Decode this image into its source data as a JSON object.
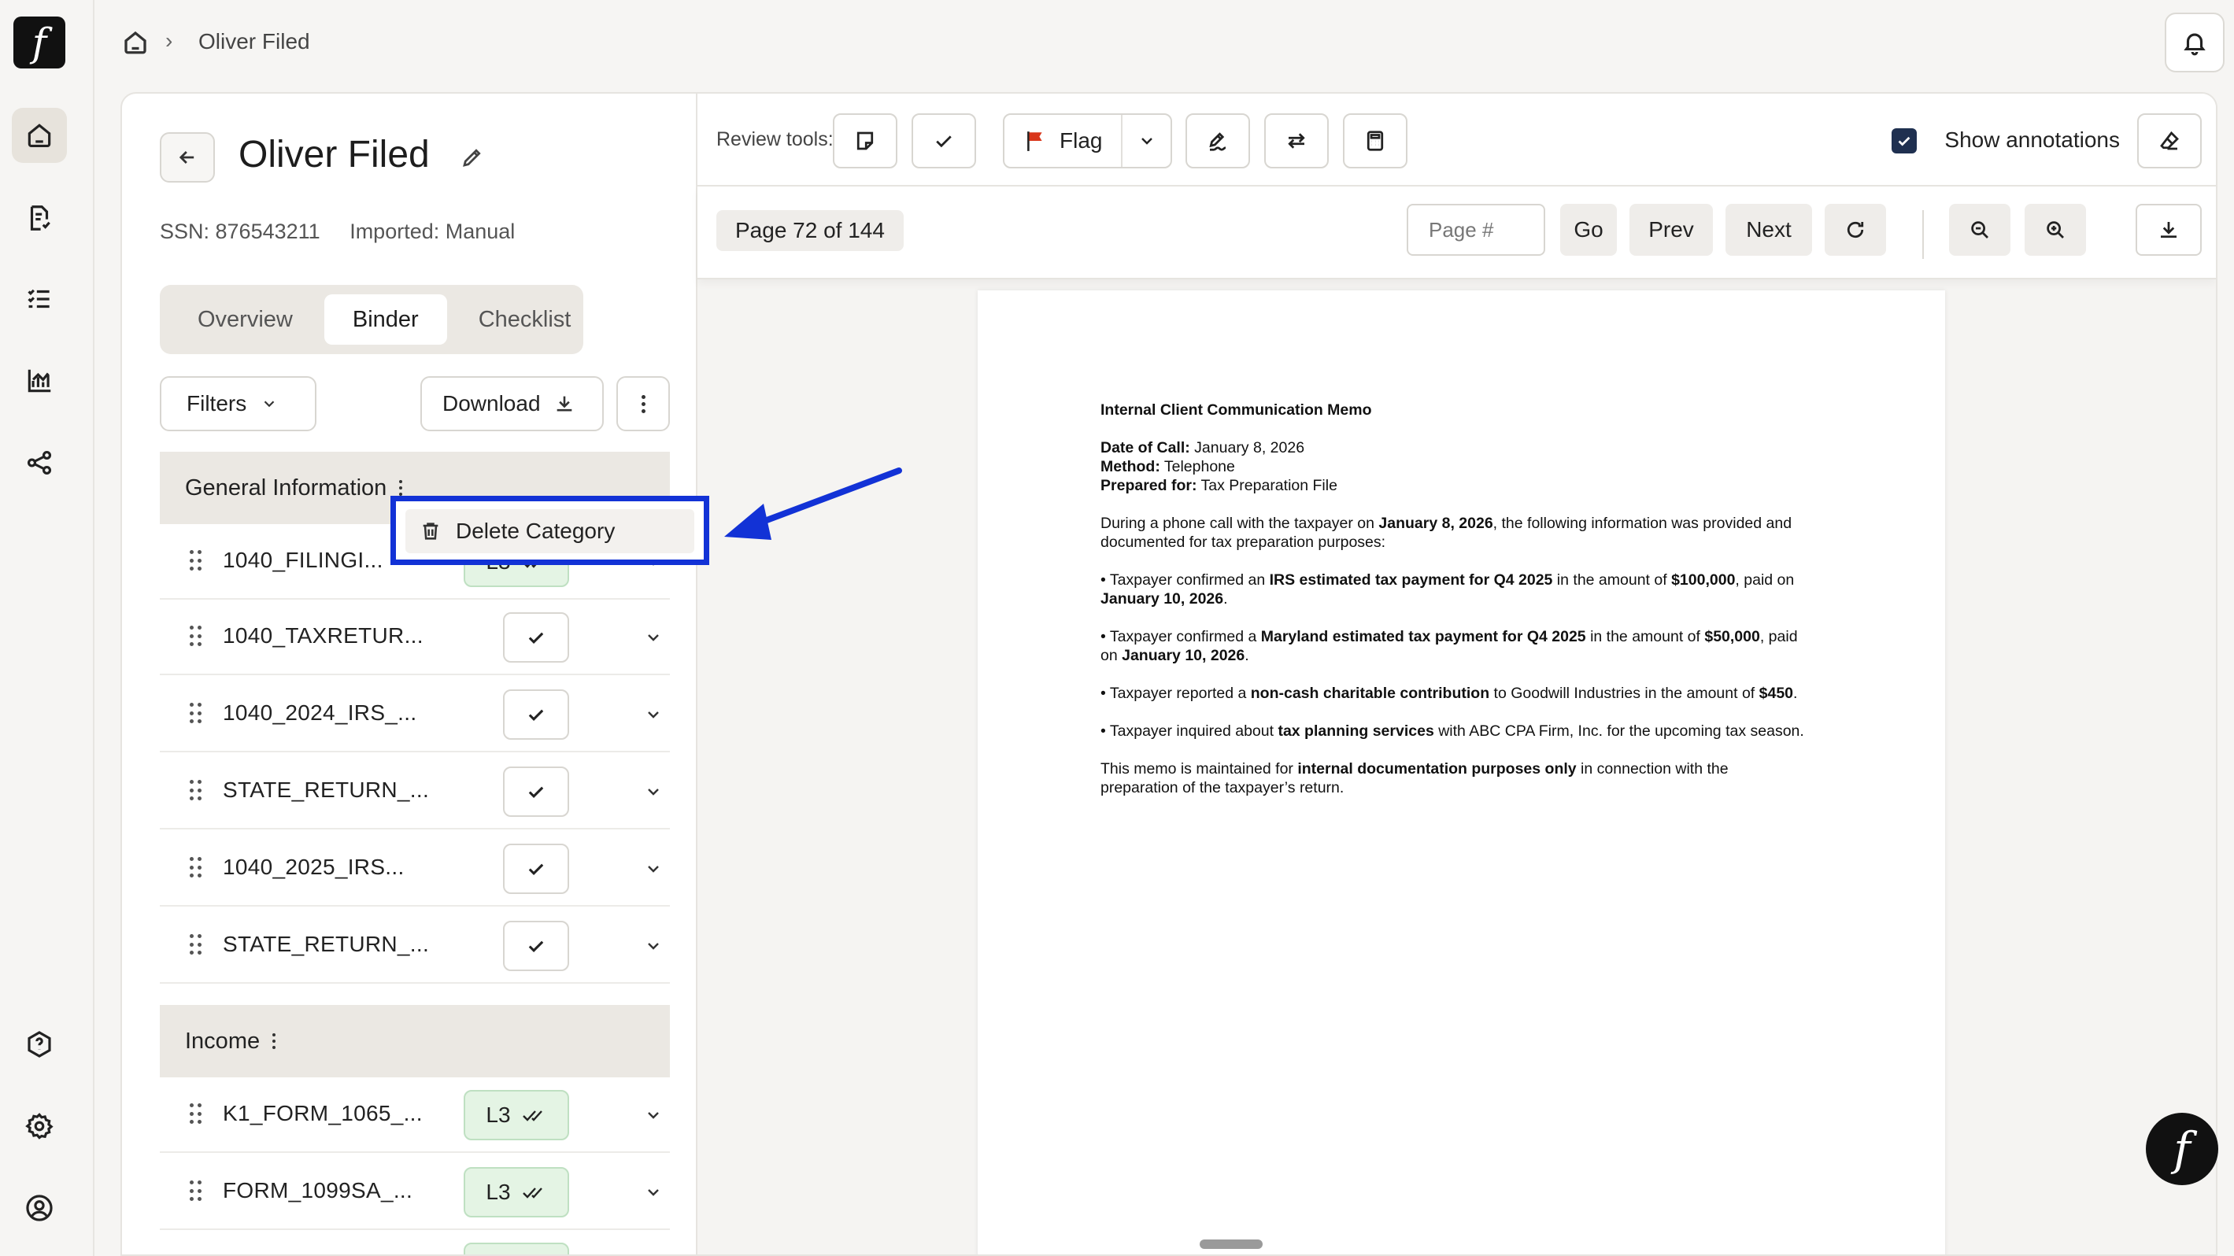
{
  "app": {
    "logo_glyph": "f",
    "fab_glyph": "f",
    "accent_color": "#1232d6"
  },
  "rail": {
    "icons": [
      "home-icon",
      "document-icon",
      "checklist-icon",
      "analytics-icon",
      "share-icon",
      "help-icon",
      "settings-icon",
      "account-icon"
    ]
  },
  "breadcrumb": {
    "current": "Oliver Filed",
    "separator": "›"
  },
  "client": {
    "name": "Oliver Filed",
    "ssn": "SSN: 876543211",
    "imported": "Imported: Manual"
  },
  "tabs": [
    "Overview",
    "Binder",
    "Checklist"
  ],
  "active_tab": "Binder",
  "controls": {
    "filters": "Filters",
    "download": "Download"
  },
  "categories": [
    {
      "name": "General Information",
      "docs": [
        {
          "name": "1040_FILINGI...",
          "status": "L3"
        },
        {
          "name": "1040_TAXRETUR...",
          "status": "check"
        },
        {
          "name": "1040_2024_IRS_...",
          "status": "check"
        },
        {
          "name": "STATE_RETURN_...",
          "status": "check"
        },
        {
          "name": "1040_2025_IRS...",
          "status": "check"
        },
        {
          "name": "STATE_RETURN_...",
          "status": "check"
        }
      ]
    },
    {
      "name": "Income",
      "docs": [
        {
          "name": "K1_FORM_1065_...",
          "status": "L3"
        },
        {
          "name": "FORM_1099SA_...",
          "status": "L3"
        }
      ]
    }
  ],
  "context_menu": {
    "item": "Delete Category"
  },
  "viewer": {
    "review_tools_label": "Review tools:",
    "flag_label": "Flag",
    "flag_color": "#d9361b",
    "show_annotations": "Show annotations",
    "page_indicator": "Page 72 of 144",
    "page_placeholder": "Page #",
    "go": "Go",
    "prev": "Prev",
    "next": "Next"
  },
  "memo": {
    "title": "Internal Client Communication Memo",
    "date_label": "Date of Call:",
    "date_value": " January 8, 2026",
    "method_label": "Method:",
    "method_value": " Telephone",
    "prepared_label": "Prepared for:",
    "prepared_value": " Tax Preparation File",
    "intro_a": "During a phone call with the taxpayer on ",
    "intro_b": "January 8, 2026",
    "intro_c": ", the following information was provided and documented for tax preparation purposes:",
    "b1_a": "• Taxpayer confirmed an ",
    "b1_b": "IRS estimated tax payment for Q4 2025",
    "b1_c": " in the amount of ",
    "b1_d": "$100,000",
    "b1_e": ", paid on ",
    "b1_f": "January 10, 2026",
    "b1_g": ".",
    "b2_a": "• Taxpayer confirmed a ",
    "b2_b": "Maryland estimated tax payment for Q4 2025",
    "b2_c": " in the amount of ",
    "b2_d": "$50,000",
    "b2_e": ", paid on ",
    "b2_f": "January 10, 2026",
    "b2_g": ".",
    "b3_a": "• Taxpayer reported a ",
    "b3_b": "non-cash charitable contribution",
    "b3_c": " to Goodwill Industries in the amount of ",
    "b3_d": "$450",
    "b3_e": ".",
    "b4_a": "• Taxpayer inquired about ",
    "b4_b": "tax planning services",
    "b4_c": " with ABC CPA Firm, Inc. for the upcoming tax season.",
    "close_a": "This memo is maintained for ",
    "close_b": "internal documentation purposes only",
    "close_c": " in connection with the preparation of the taxpayer’s return."
  }
}
